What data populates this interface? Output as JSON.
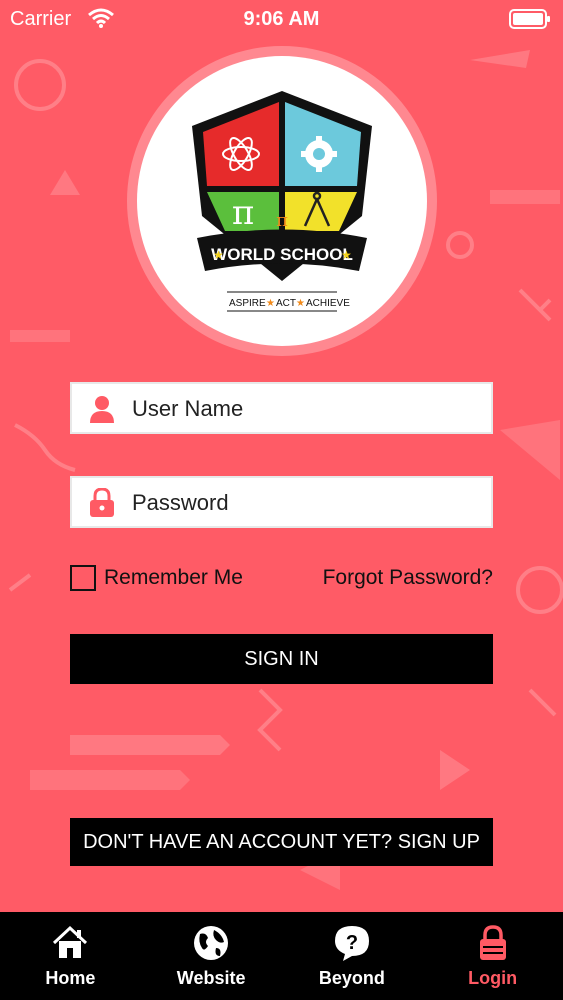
{
  "status_bar": {
    "carrier": "Carrier",
    "time": "9:06 AM"
  },
  "logo": {
    "brand_symbol": "π",
    "brand_name": "WORLD SCHOOL",
    "tagline_words": [
      "ASPIRE",
      "ACT",
      "ACHIEVE"
    ]
  },
  "form": {
    "username_placeholder": "User Name",
    "password_placeholder": "Password",
    "remember_label": "Remember Me",
    "forgot_label": "Forgot Password?",
    "sign_in_label": "SIGN IN",
    "sign_up_label": "DON'T HAVE AN ACCOUNT YET? SIGN UP"
  },
  "tabs": [
    {
      "label": "Home",
      "icon": "home-icon"
    },
    {
      "label": "Website",
      "icon": "globe-icon"
    },
    {
      "label": "Beyond",
      "icon": "question-bubble-icon"
    },
    {
      "label": "Login",
      "icon": "lock-icon"
    }
  ],
  "colors": {
    "background": "#ff5b66",
    "accent": "#ff5a64",
    "button": "#000000"
  }
}
